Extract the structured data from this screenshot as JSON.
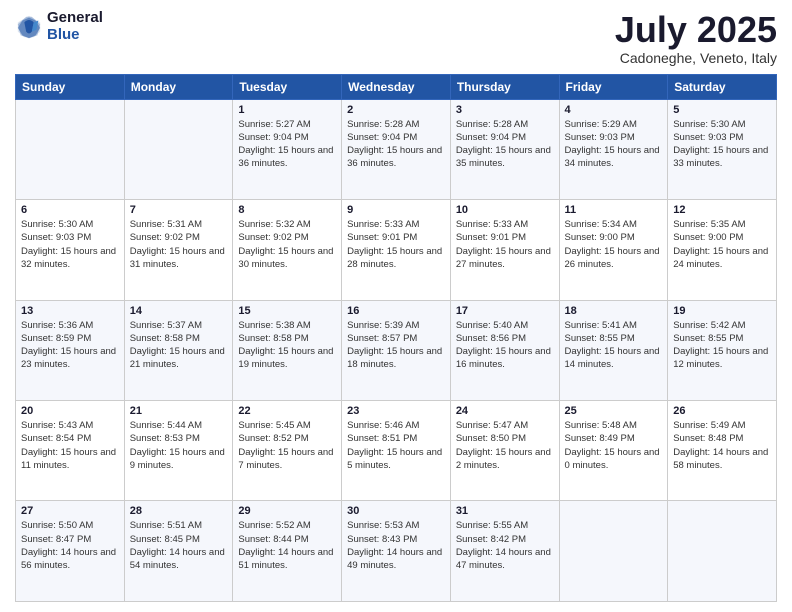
{
  "header": {
    "logo_general": "General",
    "logo_blue": "Blue",
    "month_title": "July 2025",
    "location": "Cadoneghe, Veneto, Italy"
  },
  "weekdays": [
    "Sunday",
    "Monday",
    "Tuesday",
    "Wednesday",
    "Thursday",
    "Friday",
    "Saturday"
  ],
  "weeks": [
    [
      null,
      null,
      {
        "day": 1,
        "sunrise": "5:27 AM",
        "sunset": "9:04 PM",
        "daylight": "15 hours and 36 minutes."
      },
      {
        "day": 2,
        "sunrise": "5:28 AM",
        "sunset": "9:04 PM",
        "daylight": "15 hours and 36 minutes."
      },
      {
        "day": 3,
        "sunrise": "5:28 AM",
        "sunset": "9:04 PM",
        "daylight": "15 hours and 35 minutes."
      },
      {
        "day": 4,
        "sunrise": "5:29 AM",
        "sunset": "9:03 PM",
        "daylight": "15 hours and 34 minutes."
      },
      {
        "day": 5,
        "sunrise": "5:30 AM",
        "sunset": "9:03 PM",
        "daylight": "15 hours and 33 minutes."
      }
    ],
    [
      {
        "day": 6,
        "sunrise": "5:30 AM",
        "sunset": "9:03 PM",
        "daylight": "15 hours and 32 minutes."
      },
      {
        "day": 7,
        "sunrise": "5:31 AM",
        "sunset": "9:02 PM",
        "daylight": "15 hours and 31 minutes."
      },
      {
        "day": 8,
        "sunrise": "5:32 AM",
        "sunset": "9:02 PM",
        "daylight": "15 hours and 30 minutes."
      },
      {
        "day": 9,
        "sunrise": "5:33 AM",
        "sunset": "9:01 PM",
        "daylight": "15 hours and 28 minutes."
      },
      {
        "day": 10,
        "sunrise": "5:33 AM",
        "sunset": "9:01 PM",
        "daylight": "15 hours and 27 minutes."
      },
      {
        "day": 11,
        "sunrise": "5:34 AM",
        "sunset": "9:00 PM",
        "daylight": "15 hours and 26 minutes."
      },
      {
        "day": 12,
        "sunrise": "5:35 AM",
        "sunset": "9:00 PM",
        "daylight": "15 hours and 24 minutes."
      }
    ],
    [
      {
        "day": 13,
        "sunrise": "5:36 AM",
        "sunset": "8:59 PM",
        "daylight": "15 hours and 23 minutes."
      },
      {
        "day": 14,
        "sunrise": "5:37 AM",
        "sunset": "8:58 PM",
        "daylight": "15 hours and 21 minutes."
      },
      {
        "day": 15,
        "sunrise": "5:38 AM",
        "sunset": "8:58 PM",
        "daylight": "15 hours and 19 minutes."
      },
      {
        "day": 16,
        "sunrise": "5:39 AM",
        "sunset": "8:57 PM",
        "daylight": "15 hours and 18 minutes."
      },
      {
        "day": 17,
        "sunrise": "5:40 AM",
        "sunset": "8:56 PM",
        "daylight": "15 hours and 16 minutes."
      },
      {
        "day": 18,
        "sunrise": "5:41 AM",
        "sunset": "8:55 PM",
        "daylight": "15 hours and 14 minutes."
      },
      {
        "day": 19,
        "sunrise": "5:42 AM",
        "sunset": "8:55 PM",
        "daylight": "15 hours and 12 minutes."
      }
    ],
    [
      {
        "day": 20,
        "sunrise": "5:43 AM",
        "sunset": "8:54 PM",
        "daylight": "15 hours and 11 minutes."
      },
      {
        "day": 21,
        "sunrise": "5:44 AM",
        "sunset": "8:53 PM",
        "daylight": "15 hours and 9 minutes."
      },
      {
        "day": 22,
        "sunrise": "5:45 AM",
        "sunset": "8:52 PM",
        "daylight": "15 hours and 7 minutes."
      },
      {
        "day": 23,
        "sunrise": "5:46 AM",
        "sunset": "8:51 PM",
        "daylight": "15 hours and 5 minutes."
      },
      {
        "day": 24,
        "sunrise": "5:47 AM",
        "sunset": "8:50 PM",
        "daylight": "15 hours and 2 minutes."
      },
      {
        "day": 25,
        "sunrise": "5:48 AM",
        "sunset": "8:49 PM",
        "daylight": "15 hours and 0 minutes."
      },
      {
        "day": 26,
        "sunrise": "5:49 AM",
        "sunset": "8:48 PM",
        "daylight": "14 hours and 58 minutes."
      }
    ],
    [
      {
        "day": 27,
        "sunrise": "5:50 AM",
        "sunset": "8:47 PM",
        "daylight": "14 hours and 56 minutes."
      },
      {
        "day": 28,
        "sunrise": "5:51 AM",
        "sunset": "8:45 PM",
        "daylight": "14 hours and 54 minutes."
      },
      {
        "day": 29,
        "sunrise": "5:52 AM",
        "sunset": "8:44 PM",
        "daylight": "14 hours and 51 minutes."
      },
      {
        "day": 30,
        "sunrise": "5:53 AM",
        "sunset": "8:43 PM",
        "daylight": "14 hours and 49 minutes."
      },
      {
        "day": 31,
        "sunrise": "5:55 AM",
        "sunset": "8:42 PM",
        "daylight": "14 hours and 47 minutes."
      },
      null,
      null
    ]
  ]
}
